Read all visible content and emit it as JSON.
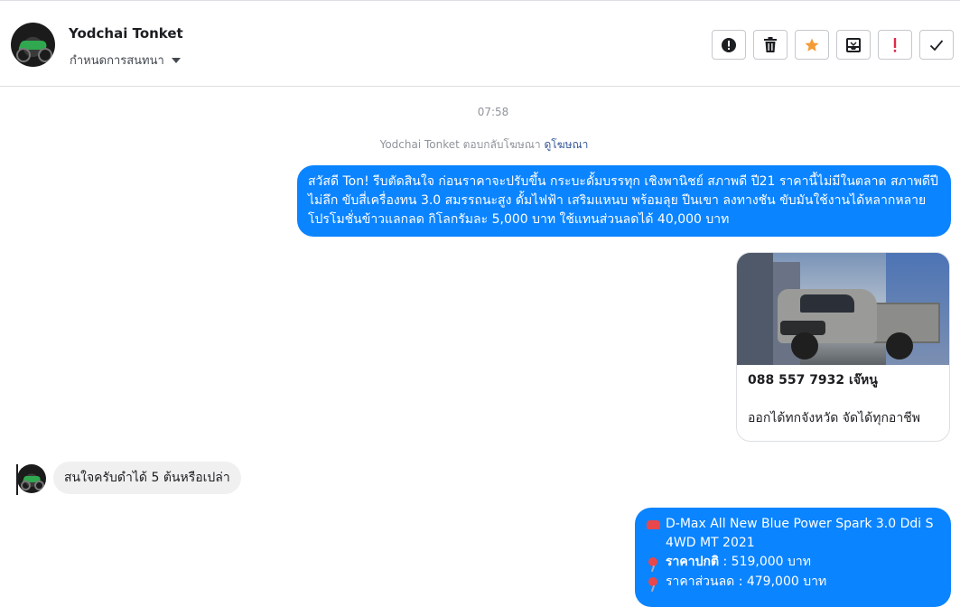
{
  "header": {
    "contact_name": "Yodchai Tonket",
    "conversation_settings": "กำหนดการสนทนา",
    "toolbar": [
      {
        "icon": "alert-circle-icon",
        "name": "report-spam-button"
      },
      {
        "icon": "trash-icon",
        "name": "delete-button"
      },
      {
        "icon": "star-icon",
        "name": "star-button"
      },
      {
        "icon": "archive-inbox-icon",
        "name": "move-to-inbox-button"
      },
      {
        "icon": "exclamation-icon",
        "name": "mark-important-button"
      },
      {
        "icon": "check-icon",
        "name": "mark-done-button"
      }
    ]
  },
  "thread": {
    "timestamp": "07:58",
    "replied_prefix": "Yodchai Tonket ตอบกลับโฆษณา",
    "view_ad_link": "ดูโฆษณา",
    "ad_message": "สวัสดี Ton! รีบตัดสินใจ ก่อนราคาจะปรับขึ้น กระบะดั้มบรรทุก เชิงพานิชย์ สภาพดี ปี21  ราคานี้ไม่มีในตลาด สภาพดีปีไม่ลึก ขับสี่เครื่องทน 3.0 สมรรถนะสูง ดั้มไฟฟ้า เสริมแหนบ พร้อมลุย ปีนเขา ลงทางชัน ขับมันใช้งานได้หลากหลาย โปรโมชั่นข้าวแลกลด กิโลกรัมละ 5,000 บาท ใช้แทนส่วนลดได้ 40,000 บาท",
    "ad_card": {
      "title": "088 557 7932 เจ๊หนู",
      "description": "ออกได้ทกจังหวัด จัดได้ทุกอาชีพ"
    },
    "incoming_message": "สนใจครับดำได้ 5 ต้นหรือเปล่า",
    "spec_message": {
      "line1": "D-Max All New Blue Power Spark 3.0 Ddi S 4WD MT 2021",
      "price_label": "ราคาปกติ",
      "price_value": ": 519,000 บาท",
      "line3": "ราคาส่วนลด : 479,000 บาท"
    }
  }
}
